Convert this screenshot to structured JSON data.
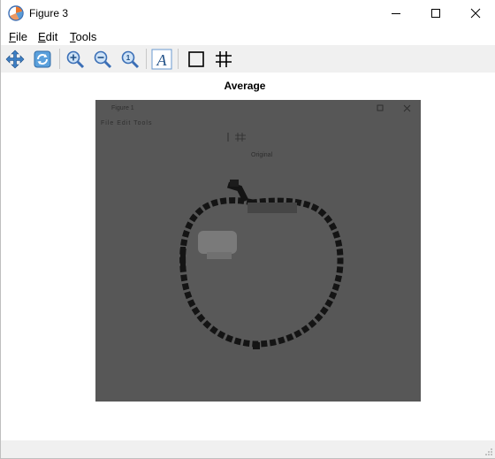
{
  "window": {
    "title": "Figure 3",
    "icon": "matplotlib-icon",
    "controls": [
      "minimize-icon",
      "maximize-icon",
      "close-icon"
    ]
  },
  "menubar": {
    "items": [
      {
        "label": "File",
        "mnemonic": "F"
      },
      {
        "label": "Edit",
        "mnemonic": "E"
      },
      {
        "label": "Tools",
        "mnemonic": "T"
      }
    ]
  },
  "toolbar": {
    "buttons": [
      "pan-icon",
      "reset-icon",
      "zoom-in-icon",
      "zoom-out-icon",
      "zoom-fit-icon",
      "axes-font-icon",
      "frame-icon",
      "grid-icon"
    ]
  },
  "plot": {
    "title": "Average"
  },
  "embedded_image": {
    "title": "Figure 1",
    "menu": "File  Edit  Tools",
    "subtitle": "Original",
    "colors": {
      "background": "#575757",
      "apple": "#595959",
      "outline": "#141414",
      "highlight": "#7a7a7a"
    }
  }
}
